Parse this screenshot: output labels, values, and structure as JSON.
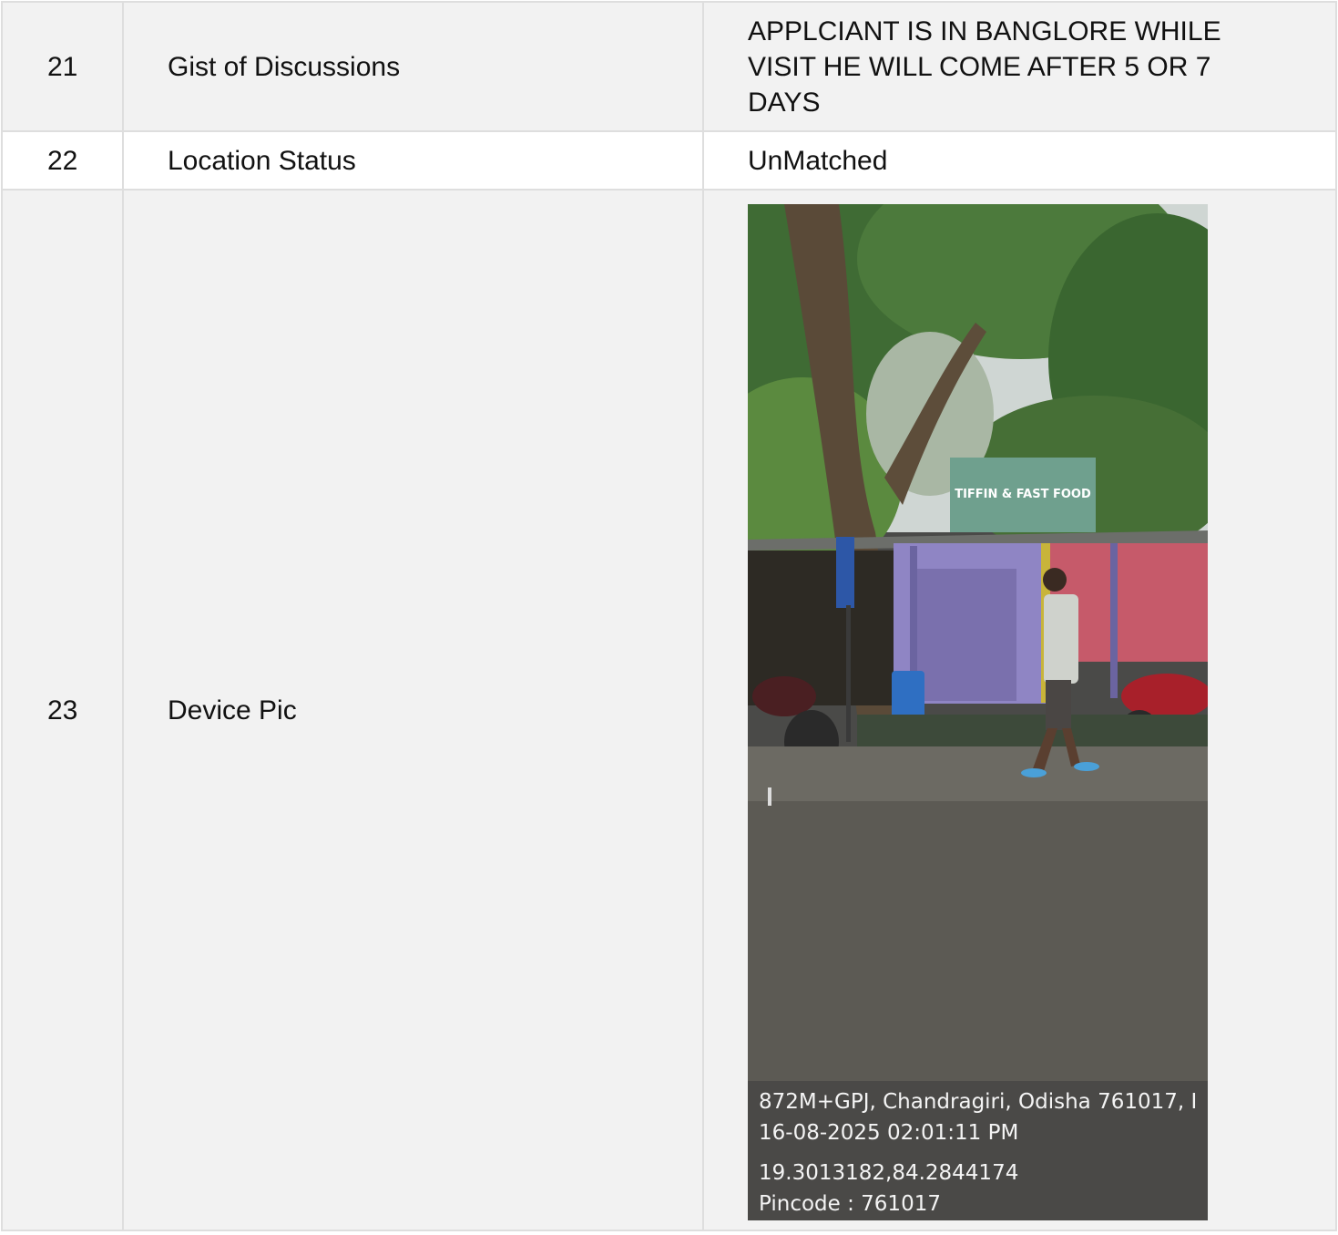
{
  "rows": [
    {
      "sn": "21",
      "label": "Gist of Discussions",
      "value": "APPLCIANT IS IN BANGLORE WHILE VISIT HE WILL COME AFTER 5 OR 7 DAYS"
    },
    {
      "sn": "22",
      "label": "Location Status",
      "value": "UnMatched"
    },
    {
      "sn": "23",
      "label": "Device Pic"
    }
  ],
  "photo": {
    "sign_text": "TIFFIN & FAST FOOD",
    "stamp": {
      "address": "872M+GPJ, Chandragiri, Odisha 761017, I",
      "datetime": "16-08-2025 02:01:11 PM",
      "coordinates": "19.3013182,84.2844174",
      "pincode": "Pincode : 761017"
    }
  }
}
